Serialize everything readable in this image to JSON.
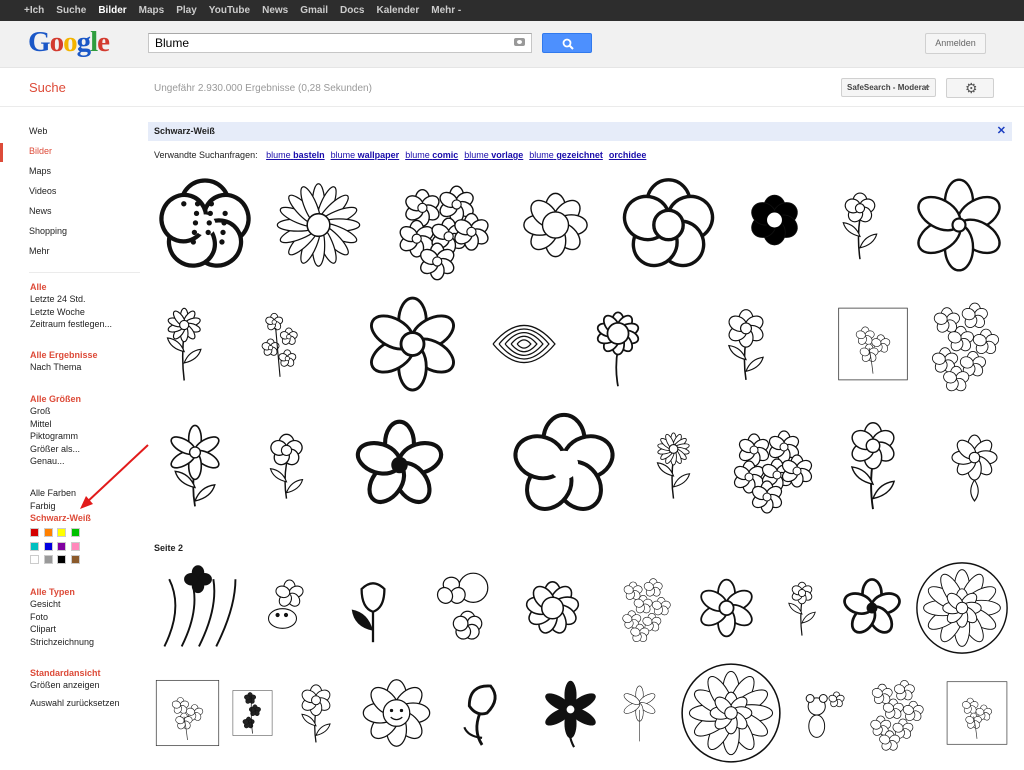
{
  "topbar": {
    "items": [
      "+Ich",
      "Suche",
      "Bilder",
      "Maps",
      "Play",
      "YouTube",
      "News",
      "Gmail",
      "Docs",
      "Kalender",
      "Mehr -"
    ],
    "active_index": 2
  },
  "header": {
    "logo_text": "Google",
    "logo_colors": [
      "#1a57c7",
      "#d33b2f",
      "#f3b400",
      "#1a57c7",
      "#2e9d3e",
      "#d33b2f"
    ],
    "search_value": "Blume",
    "signin_label": "Anmelden"
  },
  "subheader": {
    "title": "Suche",
    "results": "Ungefähr 2.930.000 Ergebnisse (0,28 Sekunden)",
    "safesearch_label": "SafeSearch - Moderat"
  },
  "leftnav": {
    "items": [
      "Web",
      "Bilder",
      "Maps",
      "Videos",
      "News",
      "Shopping",
      "Mehr"
    ],
    "active_index": 1,
    "time": {
      "head": "Alle",
      "items": [
        "Letzte 24 Std.",
        "Letzte Woche",
        "Zeitraum festlegen..."
      ]
    },
    "results": {
      "head": "Alle Ergebnisse",
      "items": [
        "Nach Thema"
      ]
    },
    "sizes": {
      "head": "Alle Größen",
      "items": [
        "Groß",
        "Mittel",
        "Piktogramm",
        "Größer als...",
        "Genau..."
      ]
    },
    "colors": {
      "items": [
        "Alle Farben",
        "Farbig",
        "Schwarz-Weiß"
      ],
      "selected_index": 2
    },
    "swatches": [
      "#d40000",
      "#ff8000",
      "#ffff00",
      "#00c000",
      "#00c0c0",
      "#0000e0",
      "#8000a0",
      "#ff88bb",
      "#ffffff",
      "#999999",
      "#000000",
      "#8b5a2b"
    ],
    "types": {
      "head": "Alle Typen",
      "items": [
        "Gesicht",
        "Foto",
        "Clipart",
        "Strichzeichnung"
      ]
    },
    "view": {
      "head": "Standardansicht",
      "items": [
        "Größen anzeigen"
      ]
    },
    "reset_label": "Auswahl zurücksetzen"
  },
  "main": {
    "filter_label": "Schwarz-Weiß",
    "close_icon": "✕",
    "related_label": "Verwandte Suchanfragen:",
    "related": [
      {
        "normal": "blume",
        "bold": "basteln"
      },
      {
        "normal": "blume",
        "bold": "wallpaper"
      },
      {
        "normal": "blume",
        "bold": "comic"
      },
      {
        "normal": "blume",
        "bold": "vorlage"
      },
      {
        "normal": "blume",
        "bold": "gezeichnet"
      },
      {
        "normal": "",
        "bold": "orchidee"
      }
    ],
    "page2_label": "Seite 2",
    "gear_icon": "⚙"
  },
  "image_rows": [
    {
      "kind": [
        "sil-spots",
        "daisy",
        "bouquet",
        "five-petal",
        "five-outline",
        "black-flower",
        "flower-stem",
        "six-outline"
      ]
    },
    {
      "kind": [
        "daisy-leaves",
        "small-flowers",
        "star-flower",
        "rose",
        "sunflower",
        "stem-flower",
        "sketch-frame",
        "sketch-dense"
      ]
    },
    {
      "kind": [
        "lily",
        "stem-tulip",
        "bold-star",
        "big-five",
        "gerbera",
        "bouquet",
        "stem-flower",
        "ornament"
      ]
    },
    {
      "kind": [
        "swirl",
        "frog-flower",
        "tulip",
        "petals-parts",
        "scallop",
        "sketch-dense",
        "star-flower",
        "narcissus",
        "bold-star",
        "mandala"
      ]
    },
    {
      "kind": [
        "sketch-frame",
        "sketch-tall",
        "stem-flower",
        "face-flower",
        "calla",
        "tribal",
        "lily-sketch",
        "mandala",
        "mouse",
        "sketch-dense",
        "sketch-frame"
      ]
    }
  ]
}
